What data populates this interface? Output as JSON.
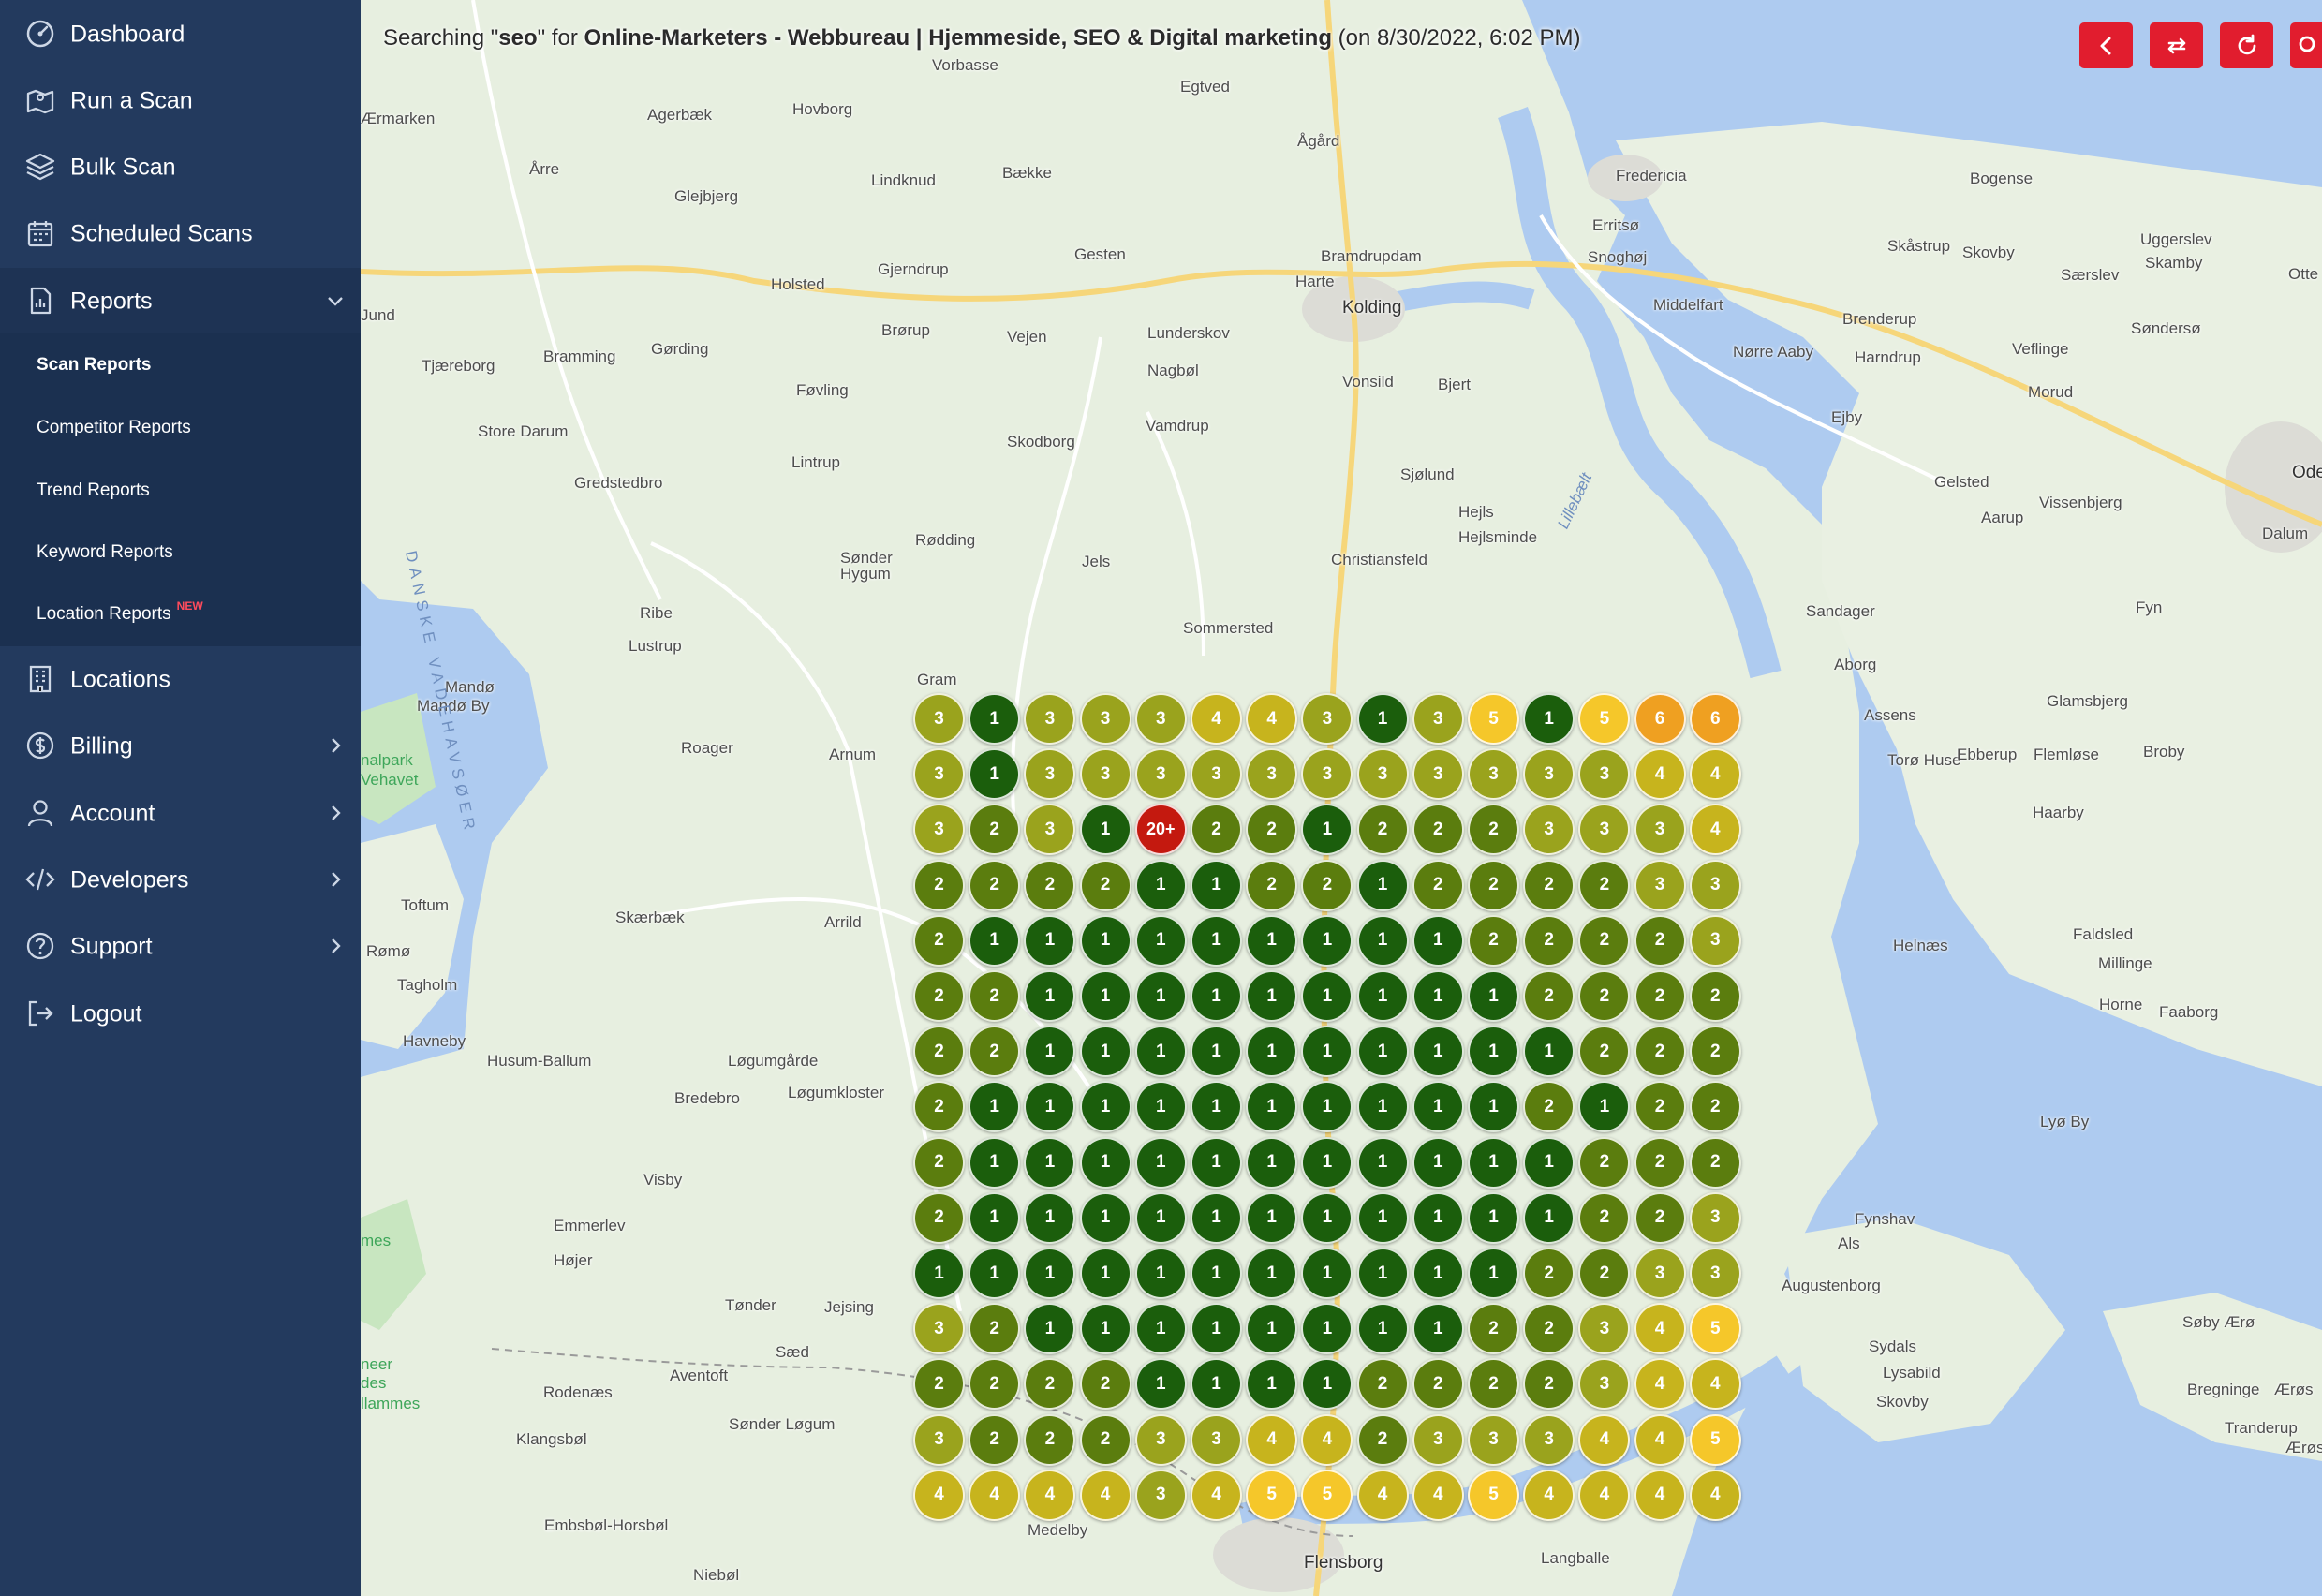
{
  "sidebar": {
    "items": [
      {
        "label": "Dashboard",
        "icon": "dashboard-gauge-icon"
      },
      {
        "label": "Run a Scan",
        "icon": "map-icon"
      },
      {
        "label": "Bulk Scan",
        "icon": "layers-icon"
      },
      {
        "label": "Scheduled Scans",
        "icon": "calendar-icon"
      },
      {
        "label": "Reports",
        "icon": "report-document-icon"
      },
      {
        "label": "Locations",
        "icon": "building-icon"
      },
      {
        "label": "Billing",
        "icon": "dollar-circle-icon"
      },
      {
        "label": "Account",
        "icon": "user-icon"
      },
      {
        "label": "Developers",
        "icon": "code-icon"
      },
      {
        "label": "Support",
        "icon": "question-circle-icon"
      },
      {
        "label": "Logout",
        "icon": "logout-icon"
      }
    ],
    "report_sub_items": [
      {
        "label": "Scan Reports"
      },
      {
        "label": "Competitor Reports"
      },
      {
        "label": "Trend Reports"
      },
      {
        "label": "Keyword Reports"
      },
      {
        "label": "Location Reports",
        "badge": "NEW"
      }
    ]
  },
  "header": {
    "prefix": "Searching \"",
    "keyword": "seo",
    "middle": "\" for ",
    "business": "Online-Marketers - Webbureau | Hjemmeside, SEO & Digital marketing",
    "suffix": " (on 8/30/2022, 6:02 PM)"
  },
  "controls": [
    {
      "icon": "chevron-left-icon"
    },
    {
      "icon": "swap-arrows-icon"
    },
    {
      "icon": "refresh-icon"
    },
    {
      "icon": "search-icon"
    }
  ],
  "colors": {
    "1": "#1b5e0c",
    "2": "#5b7d0e",
    "3": "#9aa31d",
    "4": "#c7b41d",
    "5": "#f5c72a",
    "6": "#efa021",
    "20+": "#c4190f",
    "brand_red": "#e11d2e",
    "sidebar": "#233a5e"
  },
  "rank_grid": [
    [
      "3",
      "1",
      "3",
      "3",
      "3",
      "4",
      "4",
      "3",
      "1",
      "3",
      "5",
      "1",
      "5",
      "6",
      "6"
    ],
    [
      "3",
      "1",
      "3",
      "3",
      "3",
      "3",
      "3",
      "3",
      "3",
      "3",
      "3",
      "3",
      "3",
      "4",
      "4"
    ],
    [
      "3",
      "2",
      "3",
      "1",
      "20+",
      "2",
      "2",
      "1",
      "2",
      "2",
      "2",
      "3",
      "3",
      "3",
      "4"
    ],
    [
      "2",
      "2",
      "2",
      "2",
      "1",
      "1",
      "2",
      "2",
      "1",
      "2",
      "2",
      "2",
      "2",
      "3",
      "3"
    ],
    [
      "2",
      "1",
      "1",
      "1",
      "1",
      "1",
      "1",
      "1",
      "1",
      "1",
      "2",
      "2",
      "2",
      "2",
      "3"
    ],
    [
      "2",
      "2",
      "1",
      "1",
      "1",
      "1",
      "1",
      "1",
      "1",
      "1",
      "1",
      "2",
      "2",
      "2",
      "2"
    ],
    [
      "2",
      "2",
      "1",
      "1",
      "1",
      "1",
      "1",
      "1",
      "1",
      "1",
      "1",
      "1",
      "2",
      "2",
      "2"
    ],
    [
      "2",
      "1",
      "1",
      "1",
      "1",
      "1",
      "1",
      "1",
      "1",
      "1",
      "1",
      "2",
      "1",
      "2",
      "2"
    ],
    [
      "2",
      "1",
      "1",
      "1",
      "1",
      "1",
      "1",
      "1",
      "1",
      "1",
      "1",
      "1",
      "2",
      "2",
      "2"
    ],
    [
      "2",
      "1",
      "1",
      "1",
      "1",
      "1",
      "1",
      "1",
      "1",
      "1",
      "1",
      "1",
      "2",
      "2",
      "3"
    ],
    [
      "1",
      "1",
      "1",
      "1",
      "1",
      "1",
      "1",
      "1",
      "1",
      "1",
      "1",
      "2",
      "2",
      "3",
      "3"
    ],
    [
      "3",
      "2",
      "1",
      "1",
      "1",
      "1",
      "1",
      "1",
      "1",
      "1",
      "2",
      "2",
      "3",
      "4",
      "5"
    ],
    [
      "2",
      "2",
      "2",
      "2",
      "1",
      "1",
      "1",
      "1",
      "2",
      "2",
      "2",
      "2",
      "3",
      "4",
      "4"
    ],
    [
      "3",
      "2",
      "2",
      "2",
      "3",
      "3",
      "4",
      "4",
      "2",
      "3",
      "3",
      "3",
      "4",
      "4",
      "5"
    ],
    [
      "4",
      "4",
      "4",
      "4",
      "3",
      "4",
      "5",
      "5",
      "4",
      "4",
      "5",
      "4",
      "4",
      "4",
      "4"
    ]
  ],
  "map_labels": [
    {
      "text": "Vorbasse"
    },
    {
      "text": "Egtved"
    },
    {
      "text": "Ågård"
    },
    {
      "text": "Fredericia"
    },
    {
      "text": "Bogense"
    },
    {
      "text": "Agerbæk"
    },
    {
      "text": "Hovborg"
    },
    {
      "text": "Ærmarken"
    },
    {
      "text": "Årre"
    },
    {
      "text": "Glejbjerg"
    },
    {
      "text": "Lindknud"
    },
    {
      "text": "Bække"
    },
    {
      "text": "Erritsø"
    },
    {
      "text": "Snoghøj"
    },
    {
      "text": "Skåstrup"
    },
    {
      "text": "Skovby"
    },
    {
      "text": "Særslev"
    },
    {
      "text": "Uggerslev"
    },
    {
      "text": "Skamby"
    },
    {
      "text": "Otte"
    },
    {
      "text": "Holsted"
    },
    {
      "text": "Gjerndrup"
    },
    {
      "text": "Gesten"
    },
    {
      "text": "Harte"
    },
    {
      "text": "Bramdrupdam"
    },
    {
      "text": "Kolding"
    },
    {
      "text": "Middelfart"
    },
    {
      "text": "Brenderup"
    },
    {
      "text": "Søndersø"
    },
    {
      "text": "Jund"
    },
    {
      "text": "Tjæreborg"
    },
    {
      "text": "Bramming"
    },
    {
      "text": "Gørding"
    },
    {
      "text": "Brørup"
    },
    {
      "text": "Vejen"
    },
    {
      "text": "Lunderskov"
    },
    {
      "text": "Nagbøl"
    },
    {
      "text": "Vonsild"
    },
    {
      "text": "Bjert"
    },
    {
      "text": "Nørre Aaby"
    },
    {
      "text": "Harndrup"
    },
    {
      "text": "Veflinge"
    },
    {
      "text": "Morud"
    },
    {
      "text": "Store Darum"
    },
    {
      "text": "Føvling"
    },
    {
      "text": "Skodborg"
    },
    {
      "text": "Vamdrup"
    },
    {
      "text": "Ejby"
    },
    {
      "text": "Gelsted"
    },
    {
      "text": "Aarup"
    },
    {
      "text": "Vissenbjerg"
    },
    {
      "text": "Ode"
    },
    {
      "text": "Dalum"
    },
    {
      "text": "Gredstedbro"
    },
    {
      "text": "Lintrup"
    },
    {
      "text": "Sjølund"
    },
    {
      "text": "Hejls"
    },
    {
      "text": "Hejlsminde"
    },
    {
      "text": "Rødding"
    },
    {
      "text": "Sønder Hygum"
    },
    {
      "text": "Jels"
    },
    {
      "text": "Christiansfeld"
    },
    {
      "text": "Sandager"
    },
    {
      "text": "Fyn"
    },
    {
      "text": "Ribe"
    },
    {
      "text": "Lustrup"
    },
    {
      "text": "Sommersted"
    },
    {
      "text": "Aborg"
    },
    {
      "text": "Gram"
    },
    {
      "text": "Mandø"
    },
    {
      "text": "Mandø By"
    },
    {
      "text": "Glamsbjerg"
    },
    {
      "text": "Assens"
    },
    {
      "text": "Arnum"
    },
    {
      "text": "Roager"
    },
    {
      "text": "Torø Huse"
    },
    {
      "text": "Ebberup"
    },
    {
      "text": "Flemløse"
    },
    {
      "text": "Broby"
    },
    {
      "text": "nalpark"
    },
    {
      "text": "Vehavet"
    },
    {
      "text": "Haarby"
    },
    {
      "text": "Toftum"
    },
    {
      "text": "Skærbæk"
    },
    {
      "text": "Arrild"
    },
    {
      "text": "Rømø"
    },
    {
      "text": "Helnæs"
    },
    {
      "text": "Faldsled"
    },
    {
      "text": "Tagholm"
    },
    {
      "text": "Millinge"
    },
    {
      "text": "Horne"
    },
    {
      "text": "Faaborg"
    },
    {
      "text": "Havneby"
    },
    {
      "text": "Husum-Ballum"
    },
    {
      "text": "Løgumgårde"
    },
    {
      "text": "Løgumkloster"
    },
    {
      "text": "Bredebro"
    },
    {
      "text": "Lyø By"
    },
    {
      "text": "Visby"
    },
    {
      "text": "Emmerlev"
    },
    {
      "text": "Højer"
    },
    {
      "text": "Fynshav"
    },
    {
      "text": "Als"
    },
    {
      "text": "Augustenborg"
    },
    {
      "text": "Tønder"
    },
    {
      "text": "Jejsing"
    },
    {
      "text": "Søby Ærø"
    },
    {
      "text": "Sæd"
    },
    {
      "text": "Aventoft"
    },
    {
      "text": "Sydals"
    },
    {
      "text": "Lysabild"
    },
    {
      "text": "Skovby"
    },
    {
      "text": "Rodenæs"
    },
    {
      "text": "Sønder Løgum"
    },
    {
      "text": "Bregninge"
    },
    {
      "text": "Ærøs"
    },
    {
      "text": "Tranderup"
    },
    {
      "text": "Ærøs"
    },
    {
      "text": "Klangsbøl"
    },
    {
      "text": "Embsbøl-Horsbøl"
    },
    {
      "text": "Medelby"
    },
    {
      "text": "Niebøl"
    },
    {
      "text": "Flensborg"
    },
    {
      "text": "Langballe"
    },
    {
      "text": "mes"
    },
    {
      "text": "neer"
    },
    {
      "text": "des"
    },
    {
      "text": "llammes"
    },
    {
      "text": "DANSKE VADEHAVSØER"
    },
    {
      "text": "Lillebælt"
    }
  ]
}
